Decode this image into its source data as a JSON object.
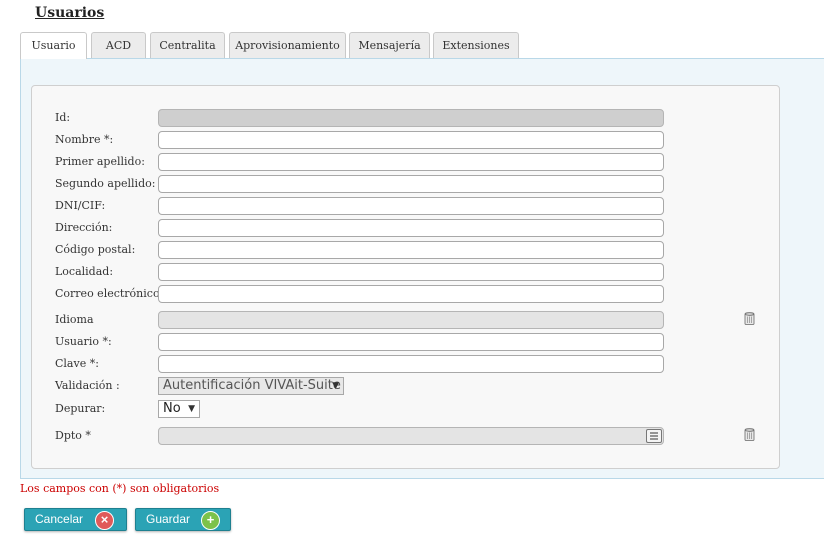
{
  "page": {
    "title": "Usuarios"
  },
  "tabs": [
    "Usuario",
    "ACD",
    "Centralita",
    "Aprovisionamiento",
    "Mensajería",
    "Extensiones"
  ],
  "form": {
    "id_label": "Id:",
    "nombre_label": "Nombre *:",
    "primer_apellido_label": "Primer apellido:",
    "segundo_apellido_label": "Segundo apellido:",
    "dni_label": "DNI/CIF:",
    "direccion_label": "Dirección:",
    "codigo_postal_label": "Código postal:",
    "localidad_label": "Localidad:",
    "correo_label": "Correo electrónico:",
    "idioma_label": "Idioma",
    "usuario_label": "Usuario *:",
    "clave_label": "Clave *:",
    "validacion_label": "Validación :",
    "validacion_value": "Autentificación VIVAit-Suite",
    "depurar_label": "Depurar:",
    "depurar_value": "No",
    "dpto_label": "Dpto *"
  },
  "note": "Los campos con (*) son obligatorios",
  "buttons": {
    "cancel": "Cancelar",
    "save": "Guardar"
  },
  "colors": {
    "button": "#2ba3b5",
    "cancel_icon": "#e05a5a",
    "save_icon": "#7cc24a",
    "note": "#cc0000"
  }
}
